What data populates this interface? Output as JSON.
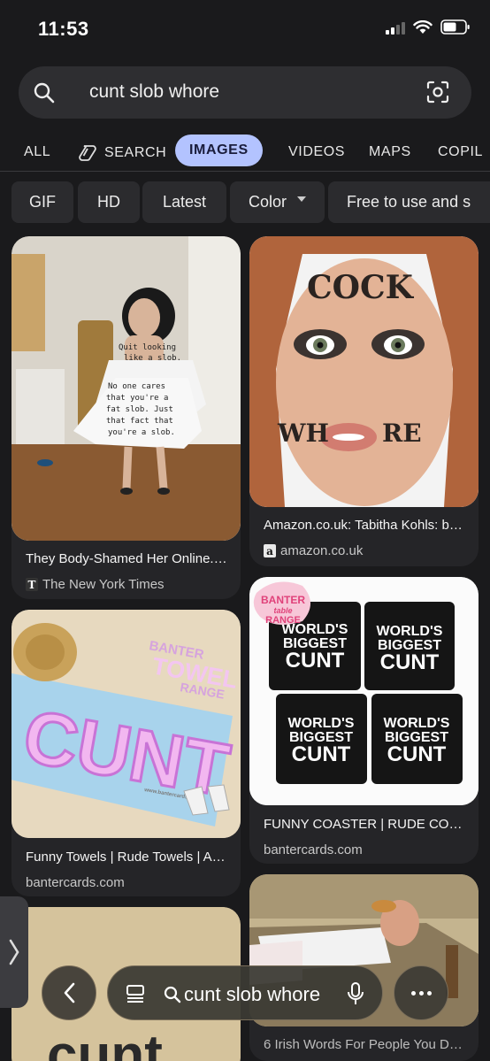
{
  "status": {
    "time": "11:53"
  },
  "search": {
    "query": "cunt slob whore"
  },
  "tabs": [
    {
      "label": "ALL"
    },
    {
      "label": "SEARCH"
    },
    {
      "label": "IMAGES"
    },
    {
      "label": "VIDEOS"
    },
    {
      "label": "MAPS"
    },
    {
      "label": "COPIL"
    }
  ],
  "filters": [
    {
      "label": "GIF"
    },
    {
      "label": "HD"
    },
    {
      "label": "Latest"
    },
    {
      "label": "Color"
    },
    {
      "label": "Free to use and s"
    }
  ],
  "results": [
    {
      "title": "They Body-Shamed Her Online.…",
      "source": "The New York Times",
      "favicon": "T",
      "image_text": [
        "Quit looking",
        "like a slob.",
        "No one cares",
        "that you're a",
        "fat slob. Just",
        "that fact that",
        "you're a slob."
      ]
    },
    {
      "title": "Amazon.co.uk: Tabitha Kohls: b…",
      "source": "amazon.co.uk",
      "favicon": "a",
      "image_text": [
        "COCK",
        "WH",
        "RE"
      ]
    },
    {
      "title": "Funny Towels | Rude Towels | A…",
      "source": "bantercards.com",
      "image_text": [
        "BANTER",
        "TOWEL",
        "RANGE",
        "CUNT",
        "www.bantercards"
      ]
    },
    {
      "title": "FUNNY COASTER | RUDE CO…",
      "source": "bantercards.com",
      "image_text": [
        "BANTER",
        "table",
        "RANGE",
        "WORLD'S",
        "BIGGEST",
        "CUNT"
      ]
    },
    {
      "image_text": [
        "cunt"
      ]
    },
    {
      "title": "6 Irish Words For People You D…"
    }
  ],
  "bottom_bar": {
    "query": "cunt slob whore"
  },
  "colors": {
    "active_tab": "#b3c3ff",
    "background": "#1a1a1c",
    "card": "#252528"
  }
}
